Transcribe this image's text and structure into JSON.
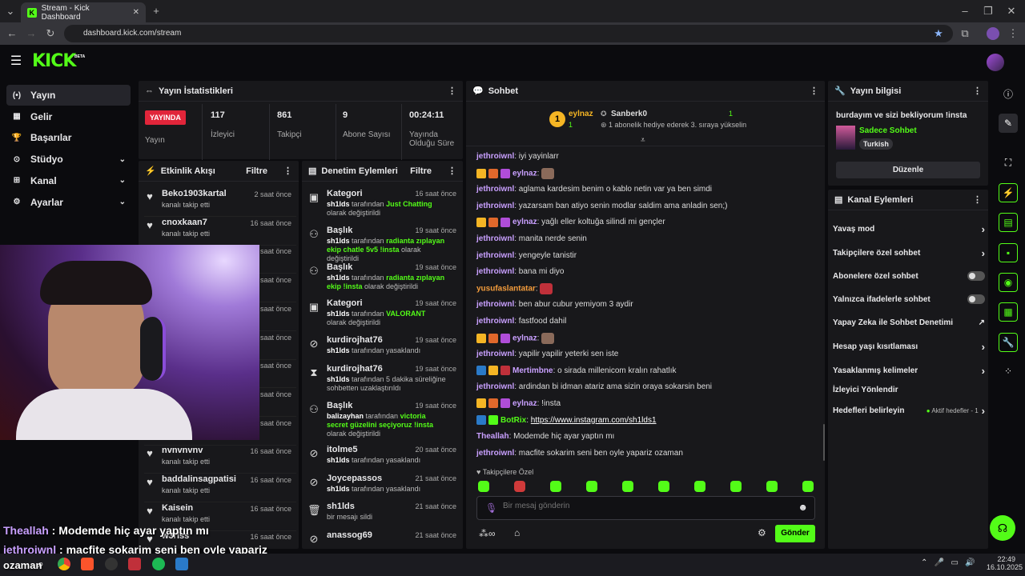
{
  "browser": {
    "tab_title": "Stream - Kick Dashboard",
    "url": "dashboard.kick.com/stream"
  },
  "brand": {
    "logo": "KICK",
    "beta": "BETA",
    "accent": "#53fc18"
  },
  "nav": [
    {
      "label": "Yayın",
      "icon": "broadcast-icon"
    },
    {
      "label": "Gelir",
      "icon": "revenue-icon"
    },
    {
      "label": "Başarılar",
      "icon": "trophy-icon"
    },
    {
      "label": "Stüdyo",
      "icon": "studio-icon"
    },
    {
      "label": "Kanal",
      "icon": "channel-icon"
    },
    {
      "label": "Ayarlar",
      "icon": "settings-icon"
    }
  ],
  "stats": {
    "title": "Yayın İstatistikleri",
    "live": "YAYINDA",
    "live_label": "Yayın",
    "items": [
      {
        "value": "117",
        "label": "İzleyici"
      },
      {
        "value": "861",
        "label": "Takipçi"
      },
      {
        "value": "9",
        "label": "Abone Sayısı"
      },
      {
        "value": "00:24:11",
        "label": "Yayında Olduğu Süre"
      }
    ]
  },
  "activity": {
    "title": "Etkinlik Akışı",
    "filter": "Filtre",
    "items": [
      {
        "name": "Beko1903kartal",
        "sub": "kanalı takip etti",
        "time": "2 saat önce"
      },
      {
        "name": "cnoxkaan7",
        "sub": "kanalı takip etti",
        "time": "16 saat önce"
      },
      {
        "name": "",
        "sub": "",
        "time": "16 saat önce"
      },
      {
        "name": "",
        "sub": "",
        "time": "16 saat önce"
      },
      {
        "name": "",
        "sub": "",
        "time": "16 saat önce"
      },
      {
        "name": "",
        "sub": "",
        "time": "16 saat önce"
      },
      {
        "name": "",
        "sub": "",
        "time": "16 saat önce"
      },
      {
        "name": "",
        "sub": "",
        "time": "16 saat önce"
      },
      {
        "name": "",
        "sub": "",
        "time": "16 saat önce"
      },
      {
        "name": "nvnvnvnv",
        "sub": "kanalı takip etti",
        "time": "16 saat önce"
      },
      {
        "name": "baddalinsagpatisi",
        "sub": "kanalı takip etti",
        "time": "16 saat önce"
      },
      {
        "name": "Kaisein",
        "sub": "kanalı takip etti",
        "time": "16 saat önce"
      },
      {
        "name": "w3rlss",
        "sub": "",
        "time": "16 saat önce"
      }
    ]
  },
  "moderation": {
    "title": "Denetim Eylemleri",
    "filter": "Filtre",
    "items": [
      {
        "name": "Kategori",
        "time": "16 saat önce",
        "actor": "sh1lds",
        "mid": " tarafından ",
        "hl": "Just Chatting",
        "end": " olarak değiştirildi"
      },
      {
        "name": "Başlık",
        "time": "19 saat önce",
        "actor": "sh1lds",
        "mid": " tarafından ",
        "hl": "radianta zıplayan ekip chatle 5v5 !insta",
        "end": " olarak değiştirildi"
      },
      {
        "name": "Başlık",
        "time": "19 saat önce",
        "actor": "sh1lds",
        "mid": " tarafından ",
        "hl": "radianta zıplayan ekip !insta",
        "end": " olarak değiştirildi"
      },
      {
        "name": "Kategori",
        "time": "19 saat önce",
        "actor": "sh1lds",
        "mid": " tarafından ",
        "hl": "VALORANT",
        "end": " olarak değiştirildi"
      },
      {
        "name": "kurdirojhat76",
        "time": "19 saat önce",
        "actor": "sh1lds",
        "mid": " tarafından yasaklandı",
        "hl": "",
        "end": ""
      },
      {
        "name": "kurdirojhat76",
        "time": "19 saat önce",
        "actor": "sh1lds",
        "mid": " tarafından 5 dakika süreliğine sohbetten uzaklaştırıldı",
        "hl": "",
        "end": ""
      },
      {
        "name": "Başlık",
        "time": "19 saat önce",
        "actor": "balizayhan",
        "mid": " tarafından ",
        "hl": "victoria secret güzelini seçiyoruz !insta",
        "end": " olarak değiştirildi"
      },
      {
        "name": "itolme5",
        "time": "20 saat önce",
        "actor": "sh1lds",
        "mid": " tarafından yasaklandı",
        "hl": "",
        "end": ""
      },
      {
        "name": "Joycepassos",
        "time": "21 saat önce",
        "actor": "sh1lds",
        "mid": " tarafından yasaklandı",
        "hl": "",
        "end": ""
      },
      {
        "name": "sh1lds",
        "time": "21 saat önce",
        "actor": "",
        "mid": "bir mesajı sildi",
        "hl": "",
        "end": ""
      },
      {
        "name": "anassog69",
        "time": "21 saat önce",
        "actor": "",
        "mid": "",
        "hl": "",
        "end": ""
      }
    ]
  },
  "chat": {
    "title": "Sohbet",
    "pinned": {
      "rank": "1",
      "user1": "eylnaz",
      "count1": "1",
      "user2": "Sanberk0",
      "count2": "1",
      "note": "1 abonelik hediye ederek 3. sıraya yükselin"
    },
    "messages": [
      {
        "user": "jethroiwnl",
        "color": "#c9a0ff",
        "text": "iyi yayinlarr",
        "badges": 0
      },
      {
        "user": "eylnaz",
        "color": "#c9a0ff",
        "text": "",
        "badges": 3,
        "emote": true
      },
      {
        "user": "jethroiwnl",
        "color": "#c9a0ff",
        "text": "aglama kardesim benim o kablo netin var ya ben simdi",
        "badges": 0
      },
      {
        "user": "jethroiwnl",
        "color": "#c9a0ff",
        "text": "yazarsam ban atiyo senin modlar saldim ama anladin sen;)",
        "badges": 0
      },
      {
        "user": "eylnaz",
        "color": "#c9a0ff",
        "text": "yağlı eller koltuğa silindi mi gençler",
        "badges": 3
      },
      {
        "user": "jethroiwnl",
        "color": "#c9a0ff",
        "text": "manita nerde senin",
        "badges": 0
      },
      {
        "user": "jethroiwnl",
        "color": "#c9a0ff",
        "text": "yengeyle tanistir",
        "badges": 0
      },
      {
        "user": "jethroiwnl",
        "color": "#c9a0ff",
        "text": "bana mi diyo",
        "badges": 0
      },
      {
        "user": "yusufaslantatar",
        "color": "#f39c3c",
        "text": "",
        "badges": 0,
        "emote": true
      },
      {
        "user": "jethroiwnl",
        "color": "#c9a0ff",
        "text": "ben abur cubur yemiyom 3 aydir",
        "badges": 0
      },
      {
        "user": "jethroiwnl",
        "color": "#c9a0ff",
        "text": "fastfood dahil",
        "badges": 0
      },
      {
        "user": "eylnaz",
        "color": "#c9a0ff",
        "text": "",
        "badges": 3,
        "emote": true
      },
      {
        "user": "jethroiwnl",
        "color": "#c9a0ff",
        "text": "yapilir yapilir yeterki sen iste",
        "badges": 0
      },
      {
        "user": "Mertimbne",
        "color": "#c9a0ff",
        "text": "o sirada millenicom kralın rahatlık",
        "badges": 3
      },
      {
        "user": "jethroiwnl",
        "color": "#c9a0ff",
        "text": "ardindan bi idman atariz ama sizin oraya sokarsin beni",
        "badges": 0
      },
      {
        "user": "eylnaz",
        "color": "#c9a0ff",
        "text": "!insta",
        "badges": 3
      },
      {
        "user": "BotRix",
        "color": "#53fc18",
        "text": "https://www.instagram.com/sh1lds1",
        "badges": 2
      },
      {
        "user": "Theallah",
        "color": "#c9a0ff",
        "text": "Modemde hiç ayar yaptın mı",
        "badges": 0
      },
      {
        "user": "jethroiwnl",
        "color": "#c9a0ff",
        "text": "macfite sokarim seni ben oyle yapariz ozaman",
        "badges": 0
      }
    ],
    "followers_only": "Takipçilere Özel",
    "placeholder": "Bir mesaj gönderin",
    "send": "Gönder"
  },
  "stream_info": {
    "title": "Yayın bilgisi",
    "stream_title": "burdayım ve sizi bekliyorum !insta",
    "category": "Sadece Sohbet",
    "tag": "Turkish",
    "edit": "Düzenle"
  },
  "channel_actions": {
    "title": "Kanal Eylemleri",
    "items": [
      {
        "label": "Yavaş mod",
        "control": "arrow"
      },
      {
        "label": "Takipçilere özel sohbet",
        "control": "arrow"
      },
      {
        "label": "Abonelere özel sohbet",
        "control": "toggle"
      },
      {
        "label": "Yalnızca ifadelerle sohbet",
        "control": "toggle"
      },
      {
        "label": "Yapay Zeka ile Sohbet Denetimi",
        "control": "external"
      },
      {
        "label": "Hesap yaşı kısıtlaması",
        "control": "arrow"
      },
      {
        "label": "Yasaklanmış kelimeler",
        "control": "arrow"
      },
      {
        "label": "İzleyici Yönlendir",
        "control": "none"
      },
      {
        "label": "Hedefleri belirleyin",
        "control": "goal",
        "extra": "Aktif hedefler - 1"
      }
    ]
  },
  "overlay": {
    "line1_user": "Theallah",
    "line1_text": "Modemde hiç ayar yaptın mı",
    "line2_user": "jethroiwnl",
    "line2_text": "macfite sokarim seni ben oyle yapariz",
    "line3": "ozaman"
  },
  "taskbar": {
    "time": "22:49",
    "date": "16.10.2025"
  }
}
